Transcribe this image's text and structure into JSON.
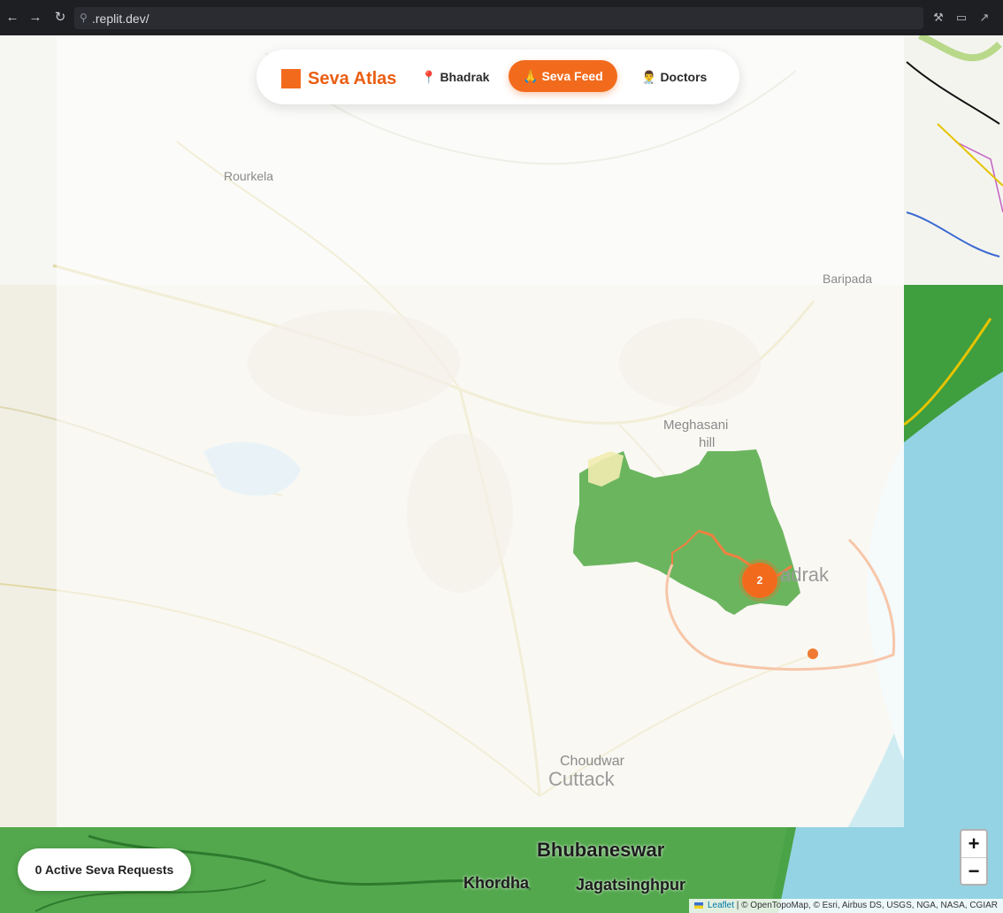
{
  "browser": {
    "url": ".replit.dev/"
  },
  "nav": {
    "brand": "Seva Atlas",
    "links": [
      {
        "label": "Bhadrak",
        "icon": "pin-icon"
      },
      {
        "label": "Seva Feed",
        "icon": "praying-hands-icon",
        "active": true
      },
      {
        "label": "Doctors",
        "icon": "doctor-icon"
      }
    ]
  },
  "status": {
    "active_requests": "0 Active Seva Requests"
  },
  "map": {
    "places": {
      "rourkela": "Rourkela",
      "baripada": "Baripada",
      "meghasani": "Meghasani",
      "hill": "hill",
      "bhadrak": "adrak",
      "choudwar": "Choudwar",
      "cuttack": "Cuttack",
      "bhubaneswar": "Bhubaneswar",
      "khordha": "Khordha",
      "jagatsinghpur": "Jagatsinghpur"
    },
    "cluster_count": "2",
    "zoom_in": "+",
    "zoom_out": "−",
    "attribution_leaflet": "Leaflet",
    "attribution_rest": "| © OpenTopoMap, © Esri, Airbus DS, USGS, NGA, NASA, CGIAR"
  },
  "colors": {
    "accent": "#f26b1d",
    "sea": "#94d3e3",
    "land_green": "#4da84a"
  }
}
